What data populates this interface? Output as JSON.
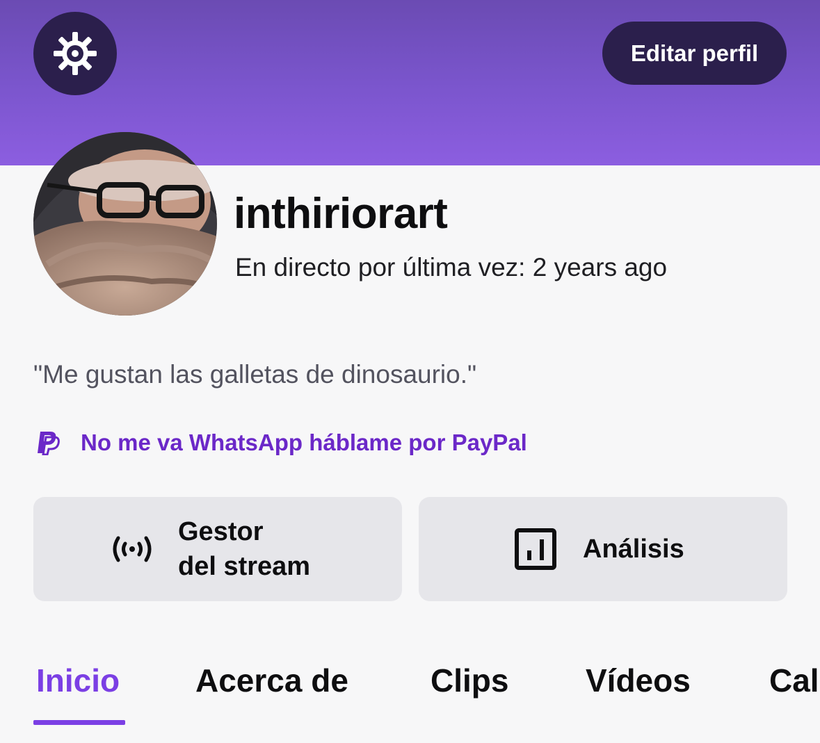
{
  "header": {
    "settings_icon": "gear-icon",
    "edit_profile_label": "Editar perfil"
  },
  "profile": {
    "avatar_icon": "avatar",
    "username": "inthiriorart",
    "last_live": "En directo por última vez: 2 years ago",
    "bio": "\"Me gustan las galletas de dinosaurio.\"",
    "link_icon": "paypal-icon",
    "link_text": "No me va WhatsApp háblame por PayPal"
  },
  "actions": {
    "stream_manager_line1": "Gestor",
    "stream_manager_line2": "del stream",
    "stream_manager_icon": "broadcast-icon",
    "analytics_label": "Análisis",
    "analytics_icon": "bar-chart-icon"
  },
  "tabs": [
    {
      "label": "Inicio",
      "active": true
    },
    {
      "label": "Acerca de",
      "active": false
    },
    {
      "label": "Clips",
      "active": false
    },
    {
      "label": "Vídeos",
      "active": false
    },
    {
      "label": "Cal",
      "active": false
    }
  ],
  "colors": {
    "brand_purple": "#7b3fe4",
    "banner_dark": "#2b1f4c",
    "link_purple": "#6b28c8"
  }
}
